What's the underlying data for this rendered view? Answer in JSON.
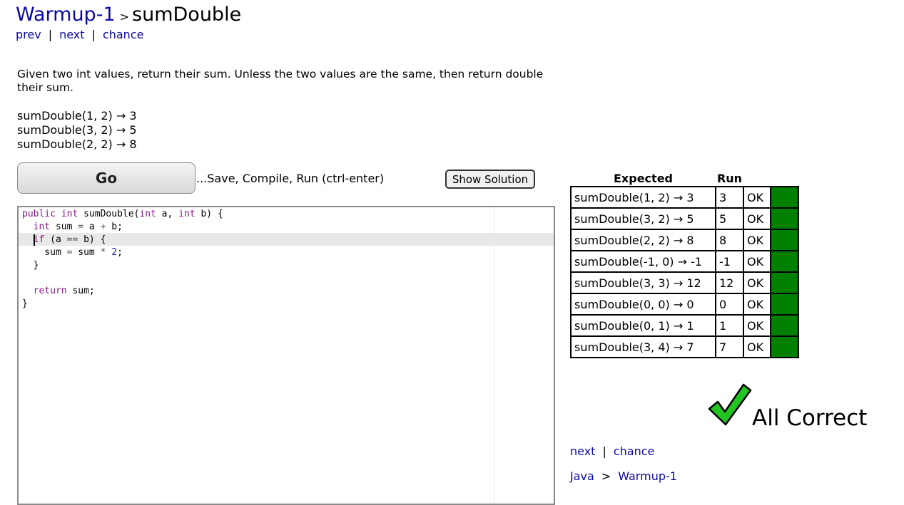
{
  "header": {
    "section": "Warmup-1",
    "separator": ">",
    "problem": "sumDouble"
  },
  "nav_top": {
    "prev": "prev",
    "next": "next",
    "chance": "chance",
    "sep": "|"
  },
  "description": "Given two int values, return their sum. Unless the two values are the same, then return double their sum.",
  "examples": [
    "sumDouble(1, 2) → 3",
    "sumDouble(3, 2) → 5",
    "sumDouble(2, 2) → 8"
  ],
  "toolbar": {
    "go_label": "Go",
    "go_hint": "...Save, Compile, Run (ctrl-enter)",
    "show_solution_label": "Show Solution"
  },
  "editor": {
    "lines": [
      "public int sumDouble(int a, int b) {",
      "  int sum = a + b;",
      "  if (a == b) {",
      "    sum = sum * 2;",
      "  }",
      "",
      "  return sum;",
      "}"
    ],
    "active_line": 3
  },
  "results": {
    "headers": {
      "expected": "Expected",
      "run": "Run"
    },
    "rows": [
      {
        "expected": "sumDouble(1, 2) → 3",
        "run": "3",
        "status": "OK",
        "color": "#007f00"
      },
      {
        "expected": "sumDouble(3, 2) → 5",
        "run": "5",
        "status": "OK",
        "color": "#007f00"
      },
      {
        "expected": "sumDouble(2, 2) → 8",
        "run": "8",
        "status": "OK",
        "color": "#007f00"
      },
      {
        "expected": "sumDouble(-1, 0) → -1",
        "run": "-1",
        "status": "OK",
        "color": "#007f00"
      },
      {
        "expected": "sumDouble(3, 3) → 12",
        "run": "12",
        "status": "OK",
        "color": "#007f00"
      },
      {
        "expected": "sumDouble(0, 0) → 0",
        "run": "0",
        "status": "OK",
        "color": "#007f00"
      },
      {
        "expected": "sumDouble(0, 1) → 1",
        "run": "1",
        "status": "OK",
        "color": "#007f00"
      },
      {
        "expected": "sumDouble(3, 4) → 7",
        "run": "7",
        "status": "OK",
        "color": "#007f00"
      }
    ]
  },
  "result_summary": {
    "text": "All Correct",
    "icon": "green-checkmark-icon",
    "color": "#22c422"
  },
  "nav_bottom": {
    "next": "next",
    "chance": "chance",
    "sep": "|"
  },
  "breadcrumb": {
    "root": "Java",
    "sep": ">",
    "section": "Warmup-1"
  },
  "colors": {
    "link": "#0a0aa6",
    "pass": "#007f00",
    "keyword": "#8b1a8b",
    "number": "#1a1aa6"
  }
}
